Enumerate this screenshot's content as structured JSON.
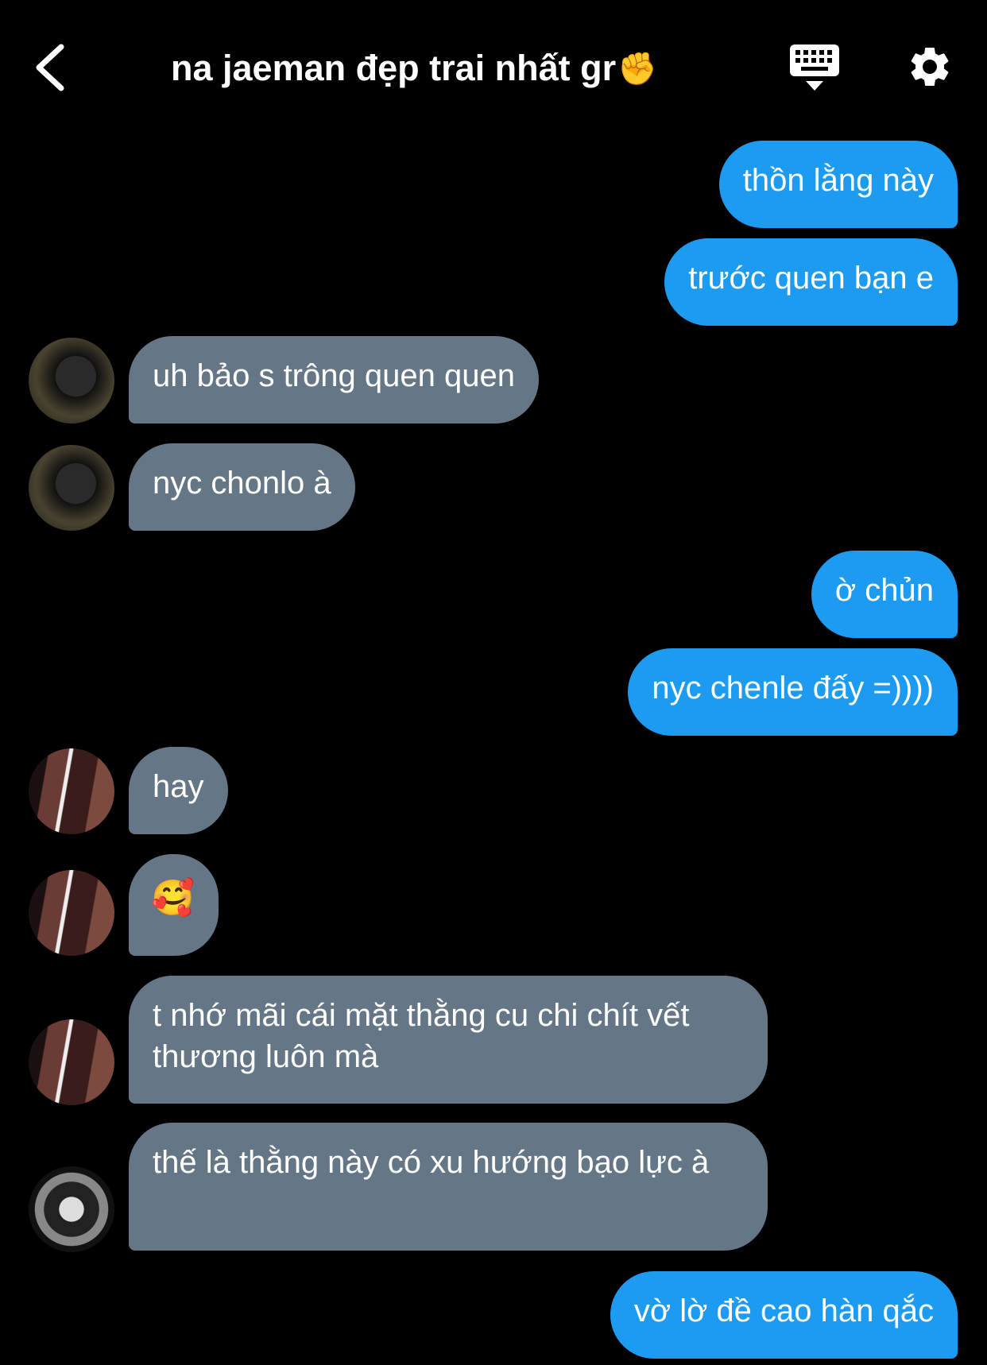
{
  "header": {
    "title": "na jaeman đẹp trai nhất gr",
    "title_emoji": "✊",
    "back_icon": "chevron-left-icon",
    "keyboard_icon": "keyboard-icon",
    "settings_icon": "gear-icon"
  },
  "colors": {
    "background": "#000000",
    "outgoing_bubble": "#1d9bf0",
    "incoming_bubble": "#657786"
  },
  "messages": [
    {
      "side": "out",
      "text": "thồn lằng này"
    },
    {
      "side": "out",
      "text": "trước quen bạn e"
    },
    {
      "side": "in",
      "avatar": "avatar-a",
      "text": "uh bảo s trông quen quen"
    },
    {
      "side": "in",
      "avatar": "avatar-a",
      "text": "nyc chonlo à"
    },
    {
      "side": "out",
      "text": "ờ chủn"
    },
    {
      "side": "out",
      "text": "nyc chenle đấy =))))"
    },
    {
      "side": "in",
      "avatar": "avatar-b",
      "text": "hay"
    },
    {
      "side": "in",
      "avatar": "avatar-b",
      "text": "🥰"
    },
    {
      "side": "in",
      "avatar": "avatar-b",
      "text": "t nhớ mãi cái mặt thằng cu chi chít vết thương luôn mà"
    },
    {
      "side": "in",
      "avatar": "avatar-c",
      "text": "thế là thằng này có xu hướng bạo lực à"
    },
    {
      "side": "out",
      "text": "vờ lờ đề cao hàn qắc"
    }
  ]
}
